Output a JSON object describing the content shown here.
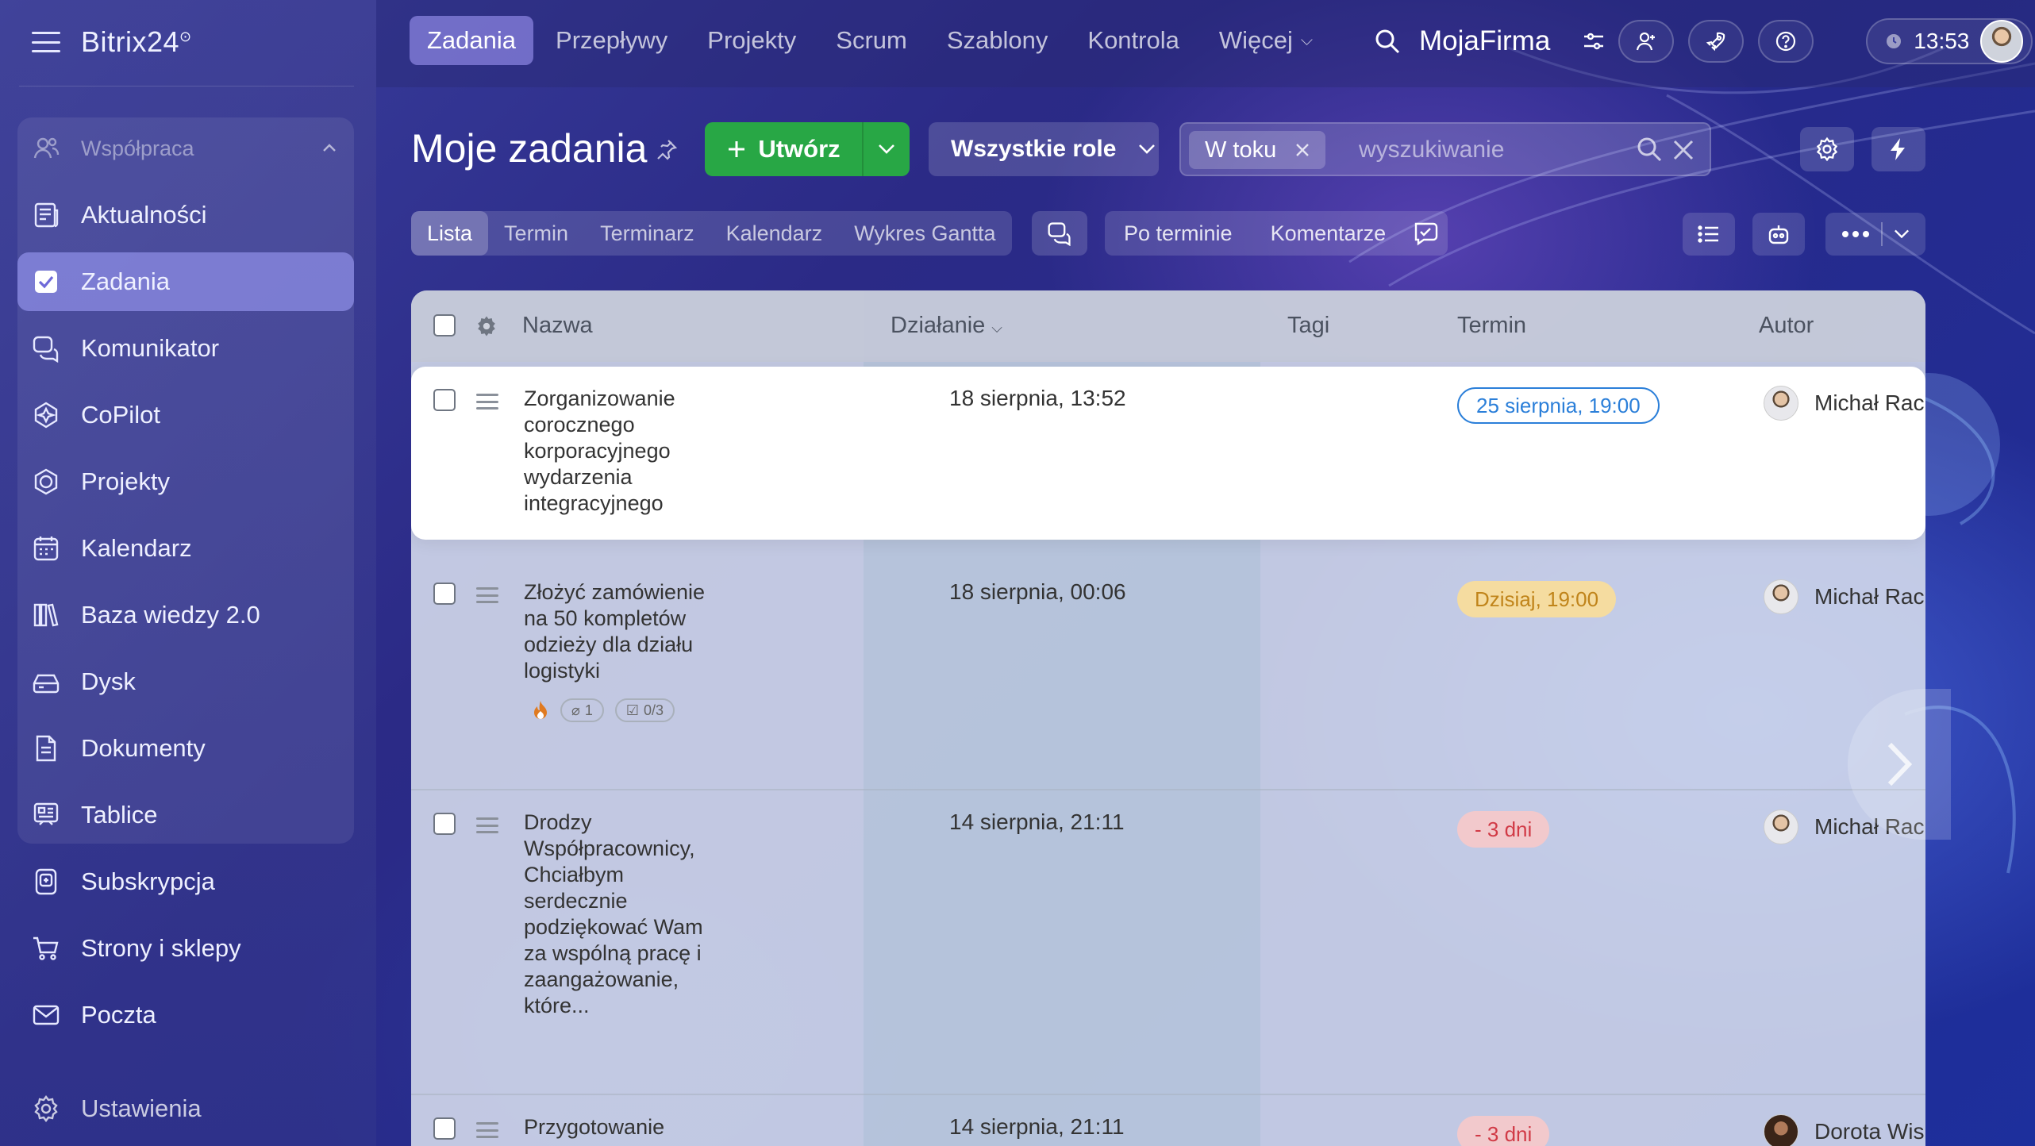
{
  "app": {
    "brand": "Bitrix24",
    "brand_mark": "⊙"
  },
  "sidebar": {
    "group_label": "Współpraca",
    "items": [
      {
        "label": "Aktualności",
        "icon": "newspaper-icon"
      },
      {
        "label": "Zadania",
        "icon": "checkbox-icon",
        "active": true
      },
      {
        "label": "Komunikator",
        "icon": "chat-icon"
      },
      {
        "label": "CoPilot",
        "icon": "copilot-icon"
      },
      {
        "label": "Projekty",
        "icon": "hexagon-icon"
      },
      {
        "label": "Kalendarz",
        "icon": "calendar-icon"
      },
      {
        "label": "Baza wiedzy 2.0",
        "icon": "library-icon"
      },
      {
        "label": "Dysk",
        "icon": "drive-icon"
      },
      {
        "label": "Dokumenty",
        "icon": "document-icon"
      },
      {
        "label": "Tablice",
        "icon": "whiteboard-icon"
      }
    ],
    "extra_items": [
      {
        "label": "Subskrypcja",
        "icon": "subscription-icon"
      },
      {
        "label": "Strony i sklepy",
        "icon": "cart-icon"
      },
      {
        "label": "Poczta",
        "icon": "mail-icon"
      }
    ],
    "settings_label": "Ustawienia"
  },
  "topbar": {
    "tabs": [
      {
        "label": "Zadania",
        "active": true
      },
      {
        "label": "Przepływy"
      },
      {
        "label": "Projekty"
      },
      {
        "label": "Scrum"
      },
      {
        "label": "Szablony"
      },
      {
        "label": "Kontrola"
      },
      {
        "label": "Więcej",
        "dropdown": true
      }
    ],
    "company": "MojaFirma",
    "clock": "13:53"
  },
  "header": {
    "title": "Moje zadania",
    "create_label": "Utwórz",
    "roles_label": "Wszystkie role",
    "filter_chip": "W toku",
    "search_placeholder": "wyszukiwanie"
  },
  "views": {
    "tabs": [
      {
        "label": "Lista",
        "active": true
      },
      {
        "label": "Termin"
      },
      {
        "label": "Terminarz"
      },
      {
        "label": "Kalendarz"
      },
      {
        "label": "Wykres Gantta"
      }
    ],
    "sort_by_deadline": "Po terminie",
    "comments": "Komentarze"
  },
  "table": {
    "columns": {
      "name": "Nazwa",
      "activity": "Działanie",
      "tags": "Tagi",
      "deadline": "Termin",
      "author": "Autor"
    },
    "rows": [
      {
        "name": "Zorganizowanie corocznego korporacyjnego wydarzenia integracyjnego",
        "activity": "18 sierpnia, 13:52",
        "deadline": "25 sierpnia, 19:00",
        "deadline_style": "blue",
        "author": "Michał Rac"
      },
      {
        "name": "Złożyć zamówienie na 50 kompletów odzieży dla działu logistyki",
        "activity": "18 sierpnia, 00:06",
        "deadline": "Dzisiaj, 19:00",
        "deadline_style": "yellow",
        "author": "Michał Rac",
        "attachments": "1",
        "checklist": "0/3"
      },
      {
        "name": "Drodzy Współpracownicy, Chciałbym serdecznie podziękować Wam za wspólną pracę i zaangażowanie, które...",
        "activity": "14 sierpnia, 21:11",
        "deadline": "- 3 dni",
        "deadline_style": "red",
        "author": "Michał Rac"
      },
      {
        "name": "Przygotowanie",
        "activity": "14 sierpnia, 21:11",
        "deadline": "- 3 dni",
        "deadline_style": "red",
        "author": "Dorota Wis"
      }
    ]
  },
  "colors": {
    "accent_green": "#28a745",
    "deadline_blue": "#2b7fd9",
    "deadline_yellow": "#c0841a",
    "deadline_red": "#d13a46"
  }
}
